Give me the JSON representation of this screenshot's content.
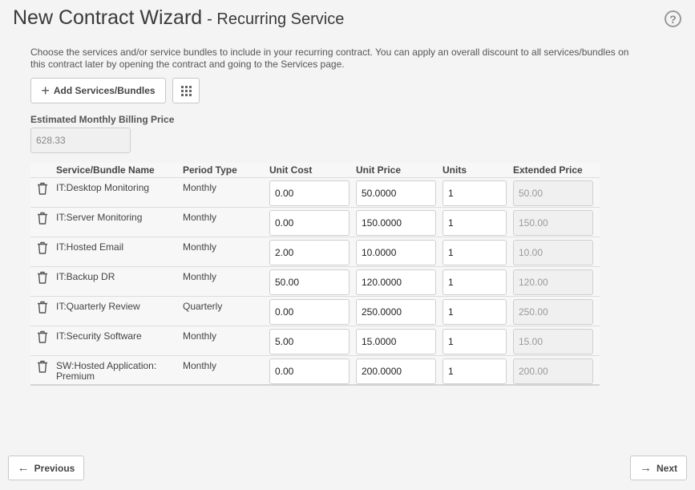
{
  "header": {
    "title": "New Contract Wizard",
    "subtitle": "- Recurring Service"
  },
  "description": "Choose the services and/or service bundles to include in your recurring contract. You can apply an overall discount to all services/bundles on this contract later by opening the contract and going to the Services page.",
  "toolbar": {
    "add_label": "Add Services/Bundles"
  },
  "estimate": {
    "label": "Estimated Monthly Billing Price",
    "value": "628.33"
  },
  "table": {
    "headers": [
      "Service/Bundle Name",
      "Period Type",
      "Unit Cost",
      "Unit Price",
      "Units",
      "Extended Price"
    ],
    "rows": [
      {
        "name": "IT:Desktop Monitoring",
        "period": "Monthly",
        "unit_cost": "0.00",
        "unit_price": "50.0000",
        "units": "1",
        "extended": "50.00"
      },
      {
        "name": "IT:Server Monitoring",
        "period": "Monthly",
        "unit_cost": "0.00",
        "unit_price": "150.0000",
        "units": "1",
        "extended": "150.00"
      },
      {
        "name": "IT:Hosted Email",
        "period": "Monthly",
        "unit_cost": "2.00",
        "unit_price": "10.0000",
        "units": "1",
        "extended": "10.00"
      },
      {
        "name": "IT:Backup DR",
        "period": "Monthly",
        "unit_cost": "50.00",
        "unit_price": "120.0000",
        "units": "1",
        "extended": "120.00"
      },
      {
        "name": "IT:Quarterly Review",
        "period": "Quarterly",
        "unit_cost": "0.00",
        "unit_price": "250.0000",
        "units": "1",
        "extended": "250.00"
      },
      {
        "name": "IT:Security Software",
        "period": "Monthly",
        "unit_cost": "5.00",
        "unit_price": "15.0000",
        "units": "1",
        "extended": "15.00"
      },
      {
        "name": "SW:Hosted Application: Premium",
        "period": "Monthly",
        "unit_cost": "0.00",
        "unit_price": "200.0000",
        "units": "1",
        "extended": "200.00"
      }
    ]
  },
  "footer": {
    "previous_label": "Previous",
    "next_label": "Next"
  },
  "icons": {
    "help": "help-icon",
    "add": "plus-icon",
    "grid": "grid-icon",
    "delete": "trash-icon",
    "previous": "arrow-left-icon",
    "next": "arrow-right-icon"
  }
}
